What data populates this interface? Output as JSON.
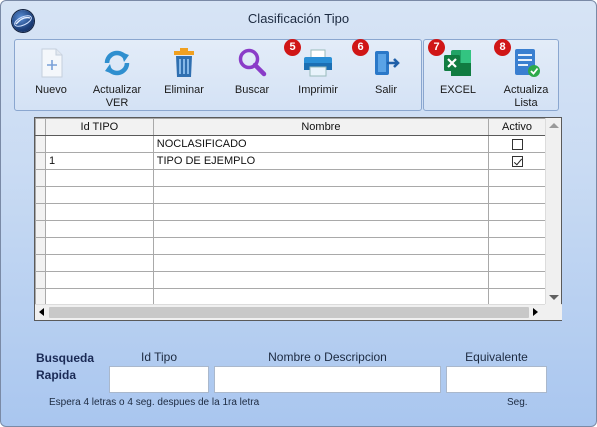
{
  "window": {
    "title": "Clasificación Tipo"
  },
  "toolbar": {
    "buttons": [
      {
        "key": "nuevo",
        "label": "Nuevo",
        "icon": "plus-document-icon"
      },
      {
        "key": "actualizar",
        "label": "Actualizar VER",
        "icon": "refresh-icon"
      },
      {
        "key": "eliminar",
        "label": "Eliminar",
        "icon": "trash-icon"
      },
      {
        "key": "buscar",
        "label": "Buscar",
        "icon": "magnifier-icon"
      },
      {
        "key": "imprimir",
        "label": "Imprimir",
        "icon": "printer-icon",
        "badge": "5"
      },
      {
        "key": "salir",
        "label": "Salir",
        "icon": "exit-icon",
        "badge": "6"
      }
    ],
    "buttons2": [
      {
        "key": "excel",
        "label": "EXCEL",
        "icon": "excel-icon",
        "badge": "7"
      },
      {
        "key": "actualiza_lista",
        "label": "Actualiza Lista",
        "icon": "list-check-icon",
        "badge": "8"
      }
    ]
  },
  "grid": {
    "columns": [
      "Id TIPO",
      "Nombre",
      "Activo"
    ],
    "rows": [
      {
        "id": "",
        "nombre": "NOCLASIFICADO",
        "activo": false
      },
      {
        "id": "1",
        "nombre": "TIPO DE EJEMPLO",
        "activo": true
      }
    ],
    "empty_rows": 8
  },
  "quick_search": {
    "label_line1": "Busqueda",
    "label_line2": "Rapida",
    "col_id": "Id Tipo",
    "col_nombre": "Nombre o Descripcion",
    "col_equivalente": "Equivalente",
    "id_value": "",
    "nombre_value": "",
    "equivalente_value": "",
    "hint": "Espera 4 letras o 4 seg. despues de la 1ra letra",
    "seg_label": "Seg."
  },
  "colors": {
    "badge": "#d01616",
    "window_gradient_top": "#d7e4f5",
    "window_gradient_bottom": "#a9c6ef"
  }
}
